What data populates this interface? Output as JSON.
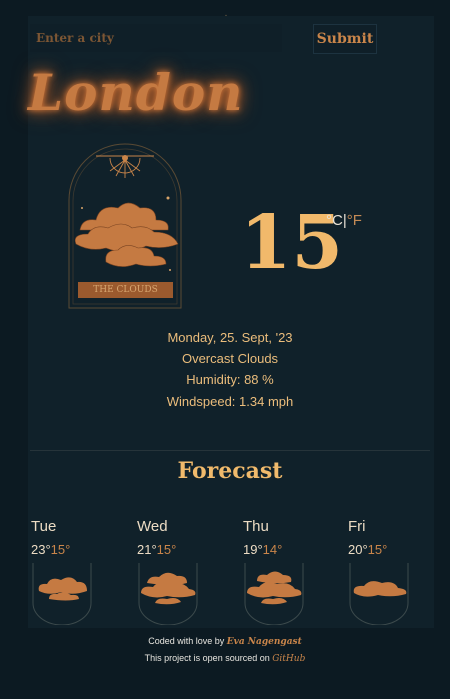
{
  "search": {
    "placeholder": "Enter a city",
    "submit_label": "Submit"
  },
  "city": "London",
  "illustration_label": "THE CLOUDS",
  "temperature": {
    "value": "15",
    "unit_c": "°C",
    "separator": "|",
    "unit_f": "°F"
  },
  "details": {
    "date": "Monday, 25. Sept, '23",
    "description": "Overcast Clouds",
    "humidity": "Humidity: 88 %",
    "windspeed": "Windspeed: 1.34 mph"
  },
  "forecast": {
    "title": "Forecast",
    "days": [
      {
        "name": "Tue",
        "high": "23°",
        "low": "15°"
      },
      {
        "name": "Wed",
        "high": "21°",
        "low": "15°"
      },
      {
        "name": "Thu",
        "high": "19°",
        "low": "14°"
      },
      {
        "name": "Fri",
        "high": "20°",
        "low": "15°"
      }
    ]
  },
  "footer": {
    "line1_prefix": "Coded with love by ",
    "author": "Eva Nagengast",
    "line2_prefix": "This project is open sourced on ",
    "repo_link": "GitHub"
  },
  "colors": {
    "background": "#0c1a22",
    "accent": "#c57a42",
    "gold": "#f1b96b"
  }
}
